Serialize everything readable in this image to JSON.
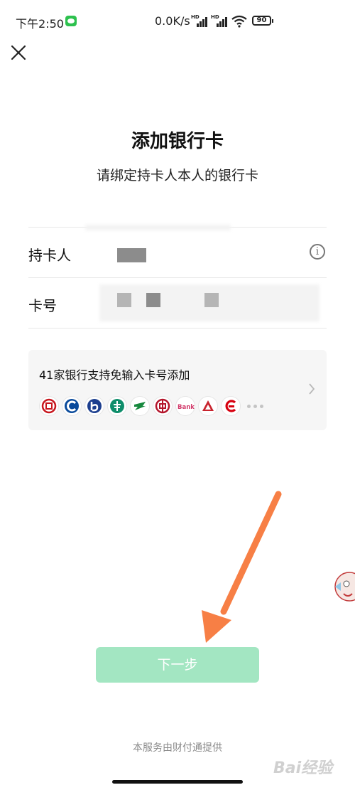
{
  "status": {
    "time": "下午2:50",
    "net_speed": "0.0K/s",
    "hd1": "HD",
    "hd2": "HD",
    "battery": "90"
  },
  "header": {
    "close_icon": "close-icon"
  },
  "page": {
    "title": "添加银行卡",
    "subtitle": "请绑定持卡人本人的银行卡"
  },
  "form": {
    "holder_label": "持卡人",
    "card_label": "卡号",
    "info_glyph": "i"
  },
  "bank_panel": {
    "title": "41家银行支持免输入卡号添加",
    "banks": [
      "icbc",
      "ccb",
      "bocom",
      "abc",
      "psbc",
      "boc",
      "bank-generic",
      "cmbc",
      "citic"
    ],
    "bank_generic_text": "Bank"
  },
  "actions": {
    "next_label": "下一步"
  },
  "footer": {
    "text": "本服务由财付通提供"
  },
  "watermark": {
    "text": "Bai经验"
  },
  "colors": {
    "accent_button": "#a3e6c2",
    "arrow": "#f77f45",
    "wechat_green": "#2dc14e"
  }
}
